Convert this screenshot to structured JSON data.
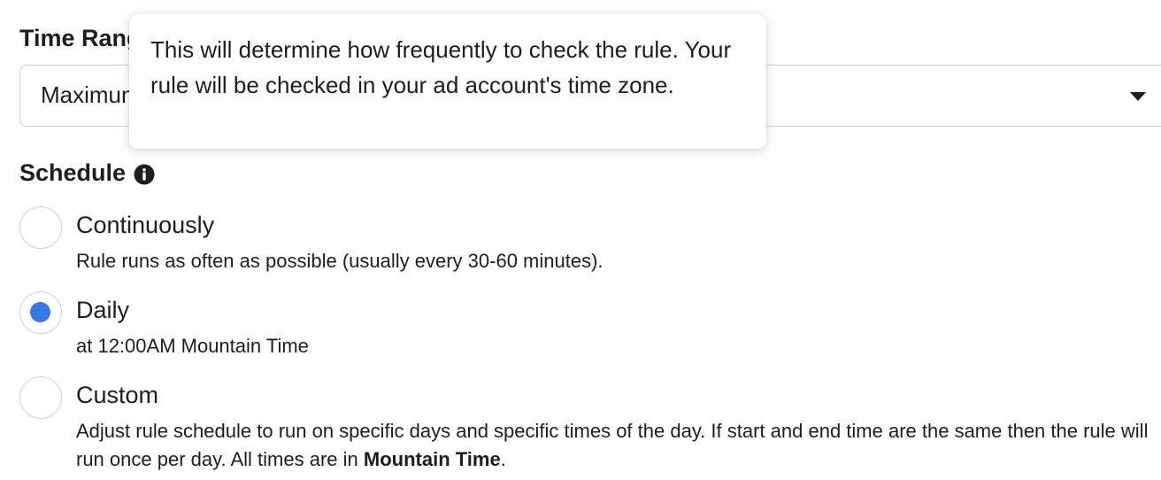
{
  "time_range": {
    "label": "Time Range",
    "selected_value": "Maximum"
  },
  "tooltip": {
    "text": "This will determine how frequently to check the rule. Your rule will be checked in your ad account's time zone."
  },
  "schedule": {
    "label": "Schedule",
    "info_icon": "info-icon",
    "options": [
      {
        "label": "Continuously",
        "description": "Rule runs as often as possible (usually every 30-60 minutes).",
        "selected": false
      },
      {
        "label": "Daily",
        "description": "at 12:00AM Mountain Time",
        "selected": true
      },
      {
        "label": "Custom",
        "description_prefix": "Adjust rule schedule to run on specific days and specific times of the day. If start and end time are the same then the rule will run once per day. All times are in ",
        "description_bold": "Mountain Time",
        "description_suffix": ".",
        "selected": false
      }
    ]
  },
  "colors": {
    "accent": "#3578e5",
    "border": "#ccd0d5",
    "text": "#1c1e21"
  }
}
